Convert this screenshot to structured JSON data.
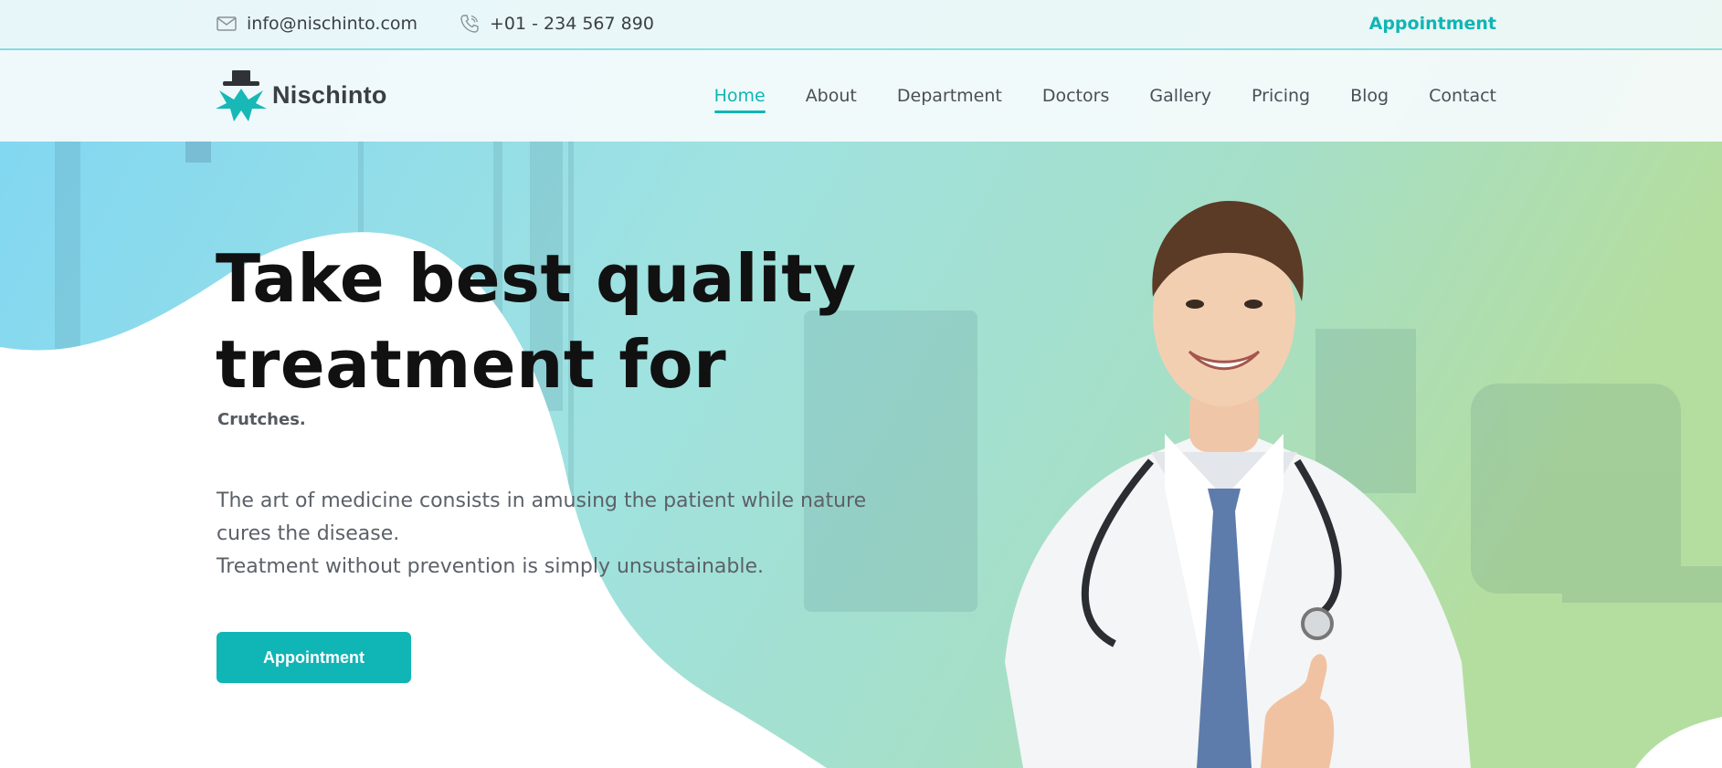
{
  "topbar": {
    "email": "info@nischinto.com",
    "email_icon": "envelope-icon",
    "phone": "+01 - 234 567 890",
    "phone_icon": "phone-icon",
    "appointment_label": "Appointment"
  },
  "navbar": {
    "brand": "Nischinto",
    "logo_icon": "medical-cross-hat-icon",
    "items": [
      {
        "label": "Home",
        "active": true
      },
      {
        "label": "About",
        "active": false
      },
      {
        "label": "Department",
        "active": false
      },
      {
        "label": "Doctors",
        "active": false
      },
      {
        "label": "Gallery",
        "active": false
      },
      {
        "label": "Pricing",
        "active": false
      },
      {
        "label": "Blog",
        "active": false
      },
      {
        "label": "Contact",
        "active": false
      }
    ]
  },
  "hero": {
    "title_line1": "Take best quality",
    "title_line2": "treatment for",
    "subtitle": "Crutches.",
    "desc_line1": "The art of medicine consists in amusing the patient while nature",
    "desc_line2": "cures the disease.",
    "desc_line3": "Treatment without prevention is simply unsustainable.",
    "button_label": "Appointment"
  },
  "colors": {
    "accent": "#10b5b5",
    "gradient_left": "#86d9f2",
    "gradient_right": "#b6e0a6"
  }
}
